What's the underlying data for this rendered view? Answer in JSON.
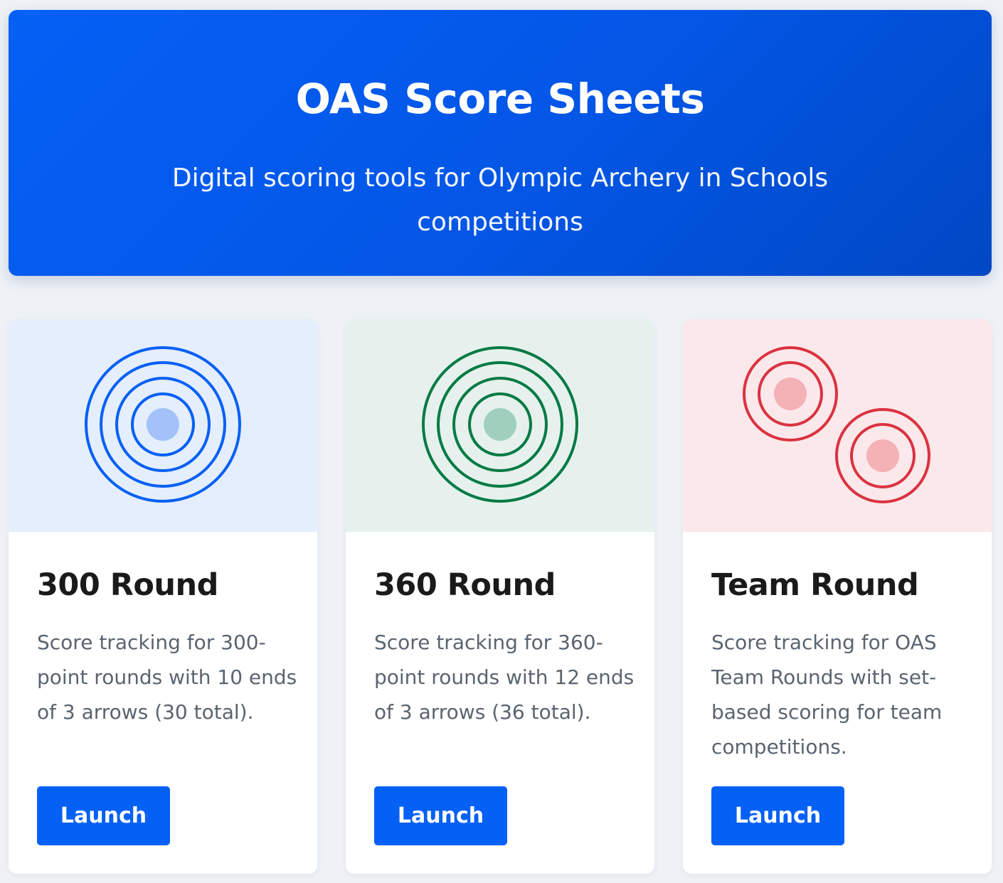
{
  "header": {
    "title": "OAS Score Sheets",
    "subtitle": "Digital scoring tools for Olympic Archery in Schools competitions"
  },
  "cards": [
    {
      "title": "300 Round",
      "description": "Score tracking for 300-point rounds with 10 ends of 3 arrows (30 total).",
      "button_label": "Launch",
      "icon": "target-icon",
      "accent": "#0560f5",
      "background": "#e5eefc",
      "center_fill": "#a3c2fa"
    },
    {
      "title": "360 Round",
      "description": "Score tracking for 360-point rounds with 12 ends of 3 arrows (36 total).",
      "button_label": "Launch",
      "icon": "target-icon",
      "accent": "#037a45",
      "background": "#e6f1ed",
      "center_fill": "#a0d0bd"
    },
    {
      "title": "Team Round",
      "description": "Score tracking for OAS Team Rounds with set-based scoring for team competitions.",
      "button_label": "Launch",
      "icon": "double-target-icon",
      "accent": "#db3240",
      "background": "#fbe8ea",
      "center_fill": "#f4b1b6"
    }
  ],
  "colors": {
    "primary": "#0560f5",
    "page_background": "#eef2f6"
  }
}
